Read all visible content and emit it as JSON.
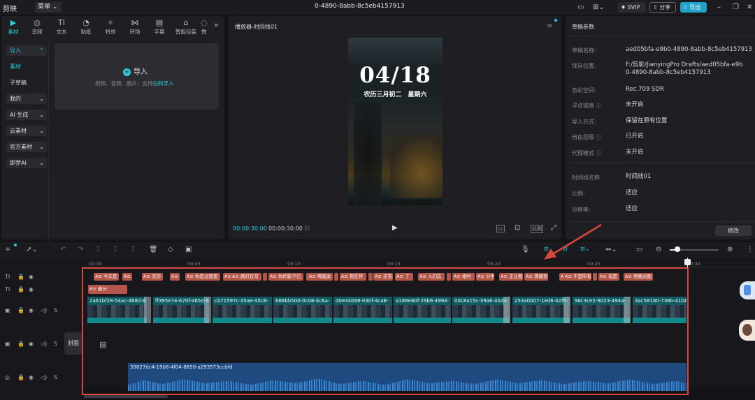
{
  "titlebar": {
    "logo": "剪映",
    "menu": "菜单",
    "title": "0-4890-8abb-8c5eb4157913",
    "svip": "SVIP",
    "share": "分享",
    "export": "导出"
  },
  "toolbar_tabs": [
    {
      "label": "素材",
      "icon": "media-icon"
    },
    {
      "label": "音频",
      "icon": "audio-icon"
    },
    {
      "label": "文本",
      "icon": "text-icon"
    },
    {
      "label": "贴纸",
      "icon": "sticker-icon"
    },
    {
      "label": "特效",
      "icon": "effect-icon"
    },
    {
      "label": "转场",
      "icon": "transition-icon"
    },
    {
      "label": "字幕",
      "icon": "caption-icon"
    },
    {
      "label": "智能包装",
      "icon": "smart-pack-icon"
    },
    {
      "label": "数",
      "icon": "more-icon"
    }
  ],
  "left_tabs": [
    "导入",
    "素材",
    "子草稿",
    "我的",
    "AI 生成",
    "云素材",
    "官方素材",
    "即梦AI"
  ],
  "import": {
    "label": "导入",
    "hint": "视频、音频、图片，支持",
    "hint_link": "扫码导入"
  },
  "player": {
    "title": "播放器-时间线01",
    "date": "04/18",
    "lunar": "农历三月初二　星期六",
    "time_current": "00:00:30:00",
    "time_total": "00:00:30:00",
    "ratio": "比例"
  },
  "props": {
    "title": "草稿参数",
    "rows": [
      {
        "label": "草稿名称:",
        "value": "aed05bfa-e9b0-4890-8abb-8c5eb4157913"
      },
      {
        "label": "保存位置:",
        "value": "F:/剪影/JianyingPro Drafts/aed05bfa-e9b0-4890-8abb-8c5eb4157913"
      },
      {
        "label": "色彩空间:",
        "value": "Rec.709 SDR"
      },
      {
        "label": "浮点链路 ⓘ",
        "value": "未开启"
      },
      {
        "label": "导入方式:",
        "value": "保留在原有位置"
      },
      {
        "label": "自由层级 ⓘ",
        "value": "已开启"
      },
      {
        "label": "代理模式 ⓘ",
        "value": "未开启"
      },
      {
        "label": "时间线名称",
        "value": "时间线01"
      },
      {
        "label": "比例:",
        "value": "适应"
      },
      {
        "label": "分辨率:",
        "value": "适应"
      }
    ],
    "modify": "修改"
  },
  "ruler": [
    "00:00",
    "00:05",
    "00:10",
    "00:15",
    "00:20",
    "00:25",
    "00:30"
  ],
  "text_track1": [
    "今天是",
    "",
    "农历",
    "",
    "你是过度思",
    "",
    "路灯在写",
    "",
    "你的影子已",
    "",
    "喝彼此",
    "",
    "抱在怀",
    "",
    "还有",
    "了",
    "人们忘",
    "",
    "相约",
    "分手",
    "正让我",
    "清晨到",
    "",
    "不是所有",
    "",
    "但是",
    "用晚对面"
  ],
  "text_track2": [
    "春分"
  ],
  "video_clips": [
    "2a61bf28-54ac-468d-8",
    "ff395e74-670f-465d-8",
    "cb71597c-35ae-45c8-",
    "668bb500-0c08-4c6a-",
    "d0e44b98-030f-4ca8-",
    "a189e80f-29b6-4994-",
    "00c8a15c-39a6-4bd4-",
    "253a0b07-1ed6-42f6-",
    "96c3ce2-9d23-494a-",
    "3ac58160-736b-41b6"
  ],
  "cover": "封面",
  "audio_clip": "39827dc4-19b8-4f04-8650-a293573ccbfd",
  "colors": {
    "accent": "#2ad0e0",
    "text_clip": "#b4574a",
    "video_clip": "#0f5d63",
    "audio_clip": "#1e4a80",
    "highlight": "#d9453f"
  }
}
